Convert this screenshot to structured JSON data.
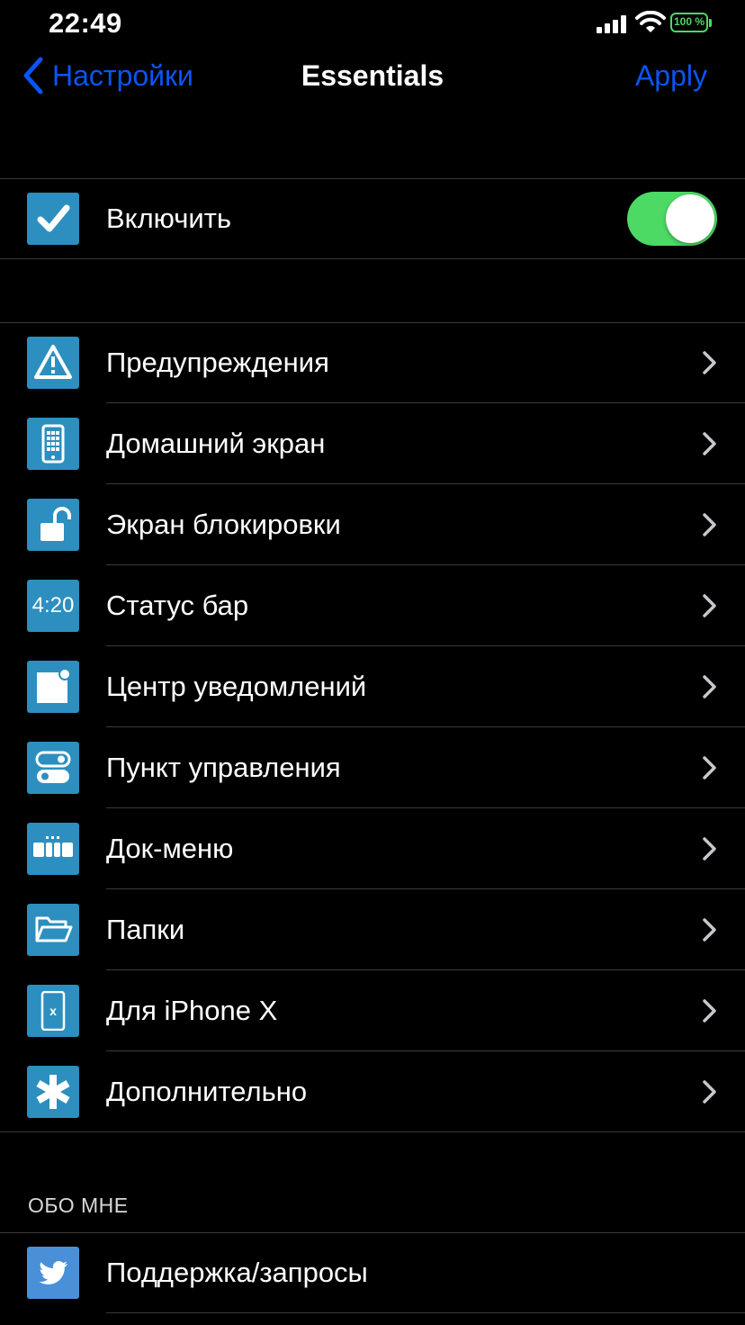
{
  "status_bar": {
    "time": "22:49",
    "battery_percent": "100 %",
    "battery_color": "#4cd964"
  },
  "nav": {
    "back_label": "Настройки",
    "title": "Essentials",
    "apply_label": "Apply",
    "accent": "#0a55f5"
  },
  "enable_row": {
    "label": "Включить",
    "icon": "checkbox-icon",
    "toggle_on": true,
    "toggle_color": "#4cd964"
  },
  "menu": {
    "items": [
      {
        "label": "Предупреждения",
        "icon": "warning-icon"
      },
      {
        "label": "Домашний экран",
        "icon": "phone-grid-icon"
      },
      {
        "label": "Экран блокировки",
        "icon": "unlock-icon"
      },
      {
        "label": "Статус бар",
        "icon": "time-icon",
        "icon_text": "4:20"
      },
      {
        "label": "Центр уведомлений",
        "icon": "notification-icon"
      },
      {
        "label": "Пункт управления",
        "icon": "toggles-icon"
      },
      {
        "label": "Док-меню",
        "icon": "dock-icon"
      },
      {
        "label": "Папки",
        "icon": "folder-icon"
      },
      {
        "label": "Для iPhone X",
        "icon": "iphone-x-icon",
        "icon_text": "x"
      },
      {
        "label": "Дополнительно",
        "icon": "asterisk-icon"
      }
    ]
  },
  "about": {
    "header": "ОБО МНЕ",
    "items": [
      {
        "label": "Поддержка/запросы",
        "icon": "twitter-icon"
      }
    ]
  },
  "icon_color": "#2c8fbf",
  "twitter_icon_color": "#4a90d9"
}
